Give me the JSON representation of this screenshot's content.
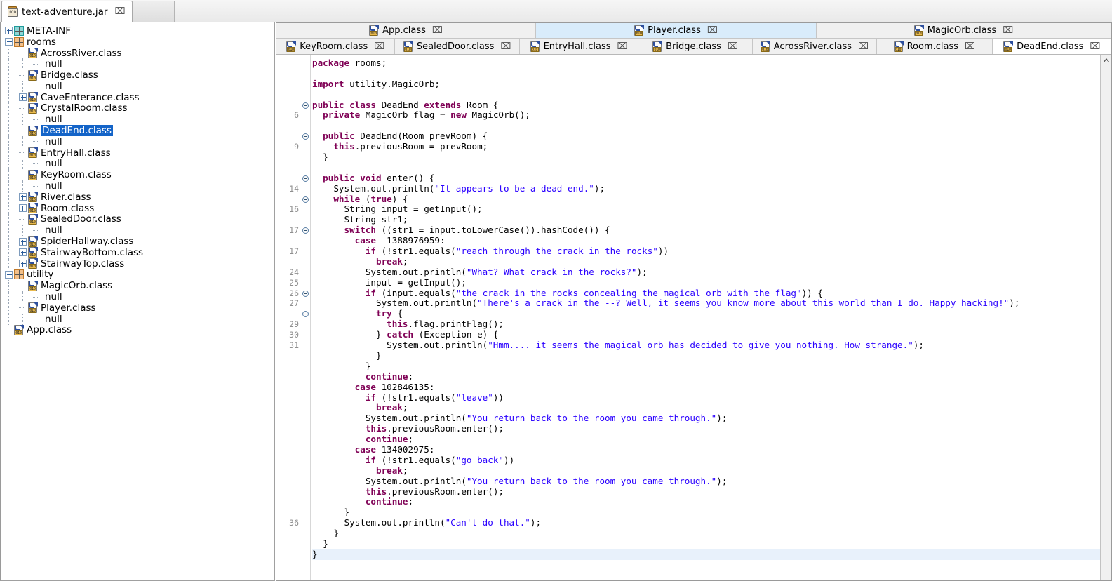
{
  "window": {
    "jar_tab": {
      "label": "text-adventure.jar",
      "icon": "jar-icon",
      "close": "⌧"
    }
  },
  "tree": {
    "nodes": [
      {
        "depth": 0,
        "label": "META-INF",
        "kind": "package",
        "icon": "package-icon",
        "expander": "plus",
        "color": "#1f9b9b"
      },
      {
        "depth": 0,
        "label": "rooms",
        "kind": "package",
        "icon": "package-icon",
        "expander": "minus",
        "color": "#c07a2c"
      },
      {
        "depth": 1,
        "label": "AcrossRiver.class",
        "kind": "class",
        "icon": "class-icon",
        "expander": "none"
      },
      {
        "depth": 2,
        "label": "null",
        "kind": "null",
        "icon": "none",
        "expander": "none"
      },
      {
        "depth": 1,
        "label": "Bridge.class",
        "kind": "class",
        "icon": "class-icon",
        "expander": "none"
      },
      {
        "depth": 2,
        "label": "null",
        "kind": "null",
        "icon": "none",
        "expander": "none"
      },
      {
        "depth": 1,
        "label": "CaveEnterance.class",
        "kind": "class",
        "icon": "class-icon",
        "expander": "plus"
      },
      {
        "depth": 1,
        "label": "CrystalRoom.class",
        "kind": "class",
        "icon": "class-icon",
        "expander": "none"
      },
      {
        "depth": 2,
        "label": "null",
        "kind": "null",
        "icon": "none",
        "expander": "none"
      },
      {
        "depth": 1,
        "label": "DeadEnd.class",
        "kind": "class",
        "icon": "class-icon",
        "expander": "none",
        "selected": true
      },
      {
        "depth": 2,
        "label": "null",
        "kind": "null",
        "icon": "none",
        "expander": "none"
      },
      {
        "depth": 1,
        "label": "EntryHall.class",
        "kind": "class",
        "icon": "class-icon",
        "expander": "none"
      },
      {
        "depth": 2,
        "label": "null",
        "kind": "null",
        "icon": "none",
        "expander": "none"
      },
      {
        "depth": 1,
        "label": "KeyRoom.class",
        "kind": "class",
        "icon": "class-icon",
        "expander": "none"
      },
      {
        "depth": 2,
        "label": "null",
        "kind": "null",
        "icon": "none",
        "expander": "none"
      },
      {
        "depth": 1,
        "label": "River.class",
        "kind": "class",
        "icon": "class-icon",
        "expander": "plus"
      },
      {
        "depth": 1,
        "label": "Room.class",
        "kind": "class",
        "icon": "class-icon",
        "expander": "plus"
      },
      {
        "depth": 1,
        "label": "SealedDoor.class",
        "kind": "class",
        "icon": "class-icon",
        "expander": "none"
      },
      {
        "depth": 2,
        "label": "null",
        "kind": "null",
        "icon": "none",
        "expander": "none"
      },
      {
        "depth": 1,
        "label": "SpiderHallway.class",
        "kind": "class",
        "icon": "class-icon",
        "expander": "plus"
      },
      {
        "depth": 1,
        "label": "StairwayBottom.class",
        "kind": "class",
        "icon": "class-icon",
        "expander": "plus"
      },
      {
        "depth": 1,
        "label": "StairwayTop.class",
        "kind": "class",
        "icon": "class-icon",
        "expander": "plus"
      },
      {
        "depth": 0,
        "label": "utility",
        "kind": "package",
        "icon": "package-icon",
        "expander": "minus",
        "color": "#c07a2c"
      },
      {
        "depth": 1,
        "label": "MagicOrb.class",
        "kind": "class",
        "icon": "class-icon",
        "expander": "none"
      },
      {
        "depth": 2,
        "label": "null",
        "kind": "null",
        "icon": "none",
        "expander": "none"
      },
      {
        "depth": 1,
        "label": "Player.class",
        "kind": "class",
        "icon": "class-icon",
        "expander": "none"
      },
      {
        "depth": 2,
        "label": "null",
        "kind": "null",
        "icon": "none",
        "expander": "none"
      },
      {
        "depth": 0,
        "label": "App.class",
        "kind": "class",
        "icon": "class-icon",
        "expander": "none",
        "leaf_root": true
      }
    ]
  },
  "editor": {
    "tab_rows": [
      {
        "tabs": [
          {
            "label": "App.class",
            "active": false,
            "highlighted": false,
            "flex": 345
          },
          {
            "label": "Player.class",
            "active": false,
            "highlighted": true,
            "flex": 375
          },
          {
            "label": "MagicOrb.class",
            "active": false,
            "highlighted": false,
            "flex": 395
          }
        ]
      },
      {
        "tabs": [
          {
            "label": "KeyRoom.class",
            "active": false,
            "highlighted": false,
            "flex": 160
          },
          {
            "label": "SealedDoor.class",
            "active": false,
            "highlighted": false,
            "flex": 168
          },
          {
            "label": "EntryHall.class",
            "active": false,
            "highlighted": false,
            "flex": 160
          },
          {
            "label": "Bridge.class",
            "active": false,
            "highlighted": false,
            "flex": 153
          },
          {
            "label": "AcrossRiver.class",
            "active": false,
            "highlighted": false,
            "flex": 168
          },
          {
            "label": "Room.class",
            "active": false,
            "highlighted": false,
            "flex": 155
          },
          {
            "label": "DeadEnd.class",
            "active": true,
            "highlighted": false,
            "flex": 160
          }
        ]
      }
    ],
    "close_glyph": "⌧",
    "scrollbar": {
      "up_arrow": "▲"
    },
    "colors": {
      "keyword": "#7f0055",
      "string": "#2a00ff",
      "plain": "#000000",
      "gutter_text": "#8f8f8f",
      "current_line_bg": "#e8f1fb",
      "selected_tab_bg": "#d9ecfb",
      "tree_selection_bg": "#1464c8"
    },
    "code_lines": [
      {
        "num": "",
        "fold": false,
        "tokens": [
          [
            "kw",
            "package"
          ],
          [
            "pln",
            " rooms;"
          ]
        ]
      },
      {
        "num": "",
        "fold": false,
        "tokens": []
      },
      {
        "num": "",
        "fold": false,
        "tokens": [
          [
            "kw",
            "import"
          ],
          [
            "pln",
            " utility.MagicOrb;"
          ]
        ]
      },
      {
        "num": "",
        "fold": false,
        "tokens": []
      },
      {
        "num": "",
        "fold": true,
        "tokens": [
          [
            "kw",
            "public class"
          ],
          [
            "pln",
            " DeadEnd "
          ],
          [
            "kw",
            "extends"
          ],
          [
            "pln",
            " Room {"
          ]
        ]
      },
      {
        "num": "6",
        "fold": false,
        "tokens": [
          [
            "pln",
            "  "
          ],
          [
            "kw",
            "private"
          ],
          [
            "pln",
            " MagicOrb flag = "
          ],
          [
            "kw",
            "new"
          ],
          [
            "pln",
            " MagicOrb();"
          ]
        ]
      },
      {
        "num": "",
        "fold": false,
        "tokens": []
      },
      {
        "num": "",
        "fold": true,
        "tokens": [
          [
            "pln",
            "  "
          ],
          [
            "kw",
            "public"
          ],
          [
            "pln",
            " DeadEnd(Room prevRoom) {"
          ]
        ]
      },
      {
        "num": "9",
        "fold": false,
        "tokens": [
          [
            "pln",
            "    "
          ],
          [
            "kw",
            "this"
          ],
          [
            "pln",
            ".previousRoom = prevRoom;"
          ]
        ]
      },
      {
        "num": "",
        "fold": false,
        "tokens": [
          [
            "pln",
            "  }"
          ]
        ]
      },
      {
        "num": "",
        "fold": false,
        "tokens": []
      },
      {
        "num": "",
        "fold": true,
        "tokens": [
          [
            "pln",
            "  "
          ],
          [
            "kw",
            "public void"
          ],
          [
            "pln",
            " enter() {"
          ]
        ]
      },
      {
        "num": "14",
        "fold": false,
        "tokens": [
          [
            "pln",
            "    System.out.println("
          ],
          [
            "str",
            "\"It appears to be a dead end.\""
          ],
          [
            "pln",
            ");"
          ]
        ]
      },
      {
        "num": "",
        "fold": true,
        "tokens": [
          [
            "pln",
            "    "
          ],
          [
            "kw",
            "while"
          ],
          [
            "pln",
            " ("
          ],
          [
            "kw",
            "true"
          ],
          [
            "pln",
            ") {"
          ]
        ]
      },
      {
        "num": "16",
        "fold": false,
        "tokens": [
          [
            "pln",
            "      String input = getInput();"
          ]
        ]
      },
      {
        "num": "",
        "fold": false,
        "tokens": [
          [
            "pln",
            "      String str1;"
          ]
        ]
      },
      {
        "num": "17",
        "fold": true,
        "tokens": [
          [
            "pln",
            "      "
          ],
          [
            "kw",
            "switch"
          ],
          [
            "pln",
            " ((str1 = input.toLowerCase()).hashCode()) {"
          ]
        ]
      },
      {
        "num": "",
        "fold": false,
        "tokens": [
          [
            "pln",
            "        "
          ],
          [
            "kw",
            "case"
          ],
          [
            "pln",
            " -1388976959:"
          ]
        ]
      },
      {
        "num": "17",
        "fold": false,
        "tokens": [
          [
            "pln",
            "          "
          ],
          [
            "kw",
            "if"
          ],
          [
            "pln",
            " (!str1.equals("
          ],
          [
            "str",
            "\"reach through the crack in the rocks\""
          ],
          [
            "pln",
            "))"
          ]
        ]
      },
      {
        "num": "",
        "fold": false,
        "tokens": [
          [
            "pln",
            "            "
          ],
          [
            "kw",
            "break"
          ],
          [
            "pln",
            ";"
          ]
        ]
      },
      {
        "num": "24",
        "fold": false,
        "tokens": [
          [
            "pln",
            "          System.out.println("
          ],
          [
            "str",
            "\"What? What crack in the rocks?\""
          ],
          [
            "pln",
            ");"
          ]
        ]
      },
      {
        "num": "25",
        "fold": false,
        "tokens": [
          [
            "pln",
            "          input = getInput();"
          ]
        ]
      },
      {
        "num": "26",
        "fold": true,
        "tokens": [
          [
            "pln",
            "          "
          ],
          [
            "kw",
            "if"
          ],
          [
            "pln",
            " (input.equals("
          ],
          [
            "str",
            "\"the crack in the rocks concealing the magical orb with the flag\""
          ],
          [
            "pln",
            ")) {"
          ]
        ]
      },
      {
        "num": "27",
        "fold": false,
        "tokens": [
          [
            "pln",
            "            System.out.println("
          ],
          [
            "str",
            "\"There's a crack in the --? Well, it seems you know more about this world than I do. Happy hacking!\""
          ],
          [
            "pln",
            ");"
          ]
        ]
      },
      {
        "num": "",
        "fold": true,
        "tokens": [
          [
            "pln",
            "            "
          ],
          [
            "kw",
            "try"
          ],
          [
            "pln",
            " {"
          ]
        ]
      },
      {
        "num": "29",
        "fold": false,
        "tokens": [
          [
            "pln",
            "              "
          ],
          [
            "kw",
            "this"
          ],
          [
            "pln",
            ".flag.printFlag();"
          ]
        ]
      },
      {
        "num": "30",
        "fold": false,
        "tokens": [
          [
            "pln",
            "            } "
          ],
          [
            "kw",
            "catch"
          ],
          [
            "pln",
            " (Exception e) {"
          ]
        ]
      },
      {
        "num": "31",
        "fold": false,
        "tokens": [
          [
            "pln",
            "              System.out.println("
          ],
          [
            "str",
            "\"Hmm.... it seems the magical orb has decided to give you nothing. How strange.\""
          ],
          [
            "pln",
            ");"
          ]
        ]
      },
      {
        "num": "",
        "fold": false,
        "tokens": [
          [
            "pln",
            "            }"
          ]
        ]
      },
      {
        "num": "",
        "fold": false,
        "tokens": [
          [
            "pln",
            "          }"
          ]
        ]
      },
      {
        "num": "",
        "fold": false,
        "tokens": [
          [
            "pln",
            "          "
          ],
          [
            "kw",
            "continue"
          ],
          [
            "pln",
            ";"
          ]
        ]
      },
      {
        "num": "",
        "fold": false,
        "tokens": [
          [
            "pln",
            "        "
          ],
          [
            "kw",
            "case"
          ],
          [
            "pln",
            " 102846135:"
          ]
        ]
      },
      {
        "num": "",
        "fold": false,
        "tokens": [
          [
            "pln",
            "          "
          ],
          [
            "kw",
            "if"
          ],
          [
            "pln",
            " (!str1.equals("
          ],
          [
            "str",
            "\"leave\""
          ],
          [
            "pln",
            "))"
          ]
        ]
      },
      {
        "num": "",
        "fold": false,
        "tokens": [
          [
            "pln",
            "            "
          ],
          [
            "kw",
            "break"
          ],
          [
            "pln",
            ";"
          ]
        ]
      },
      {
        "num": "",
        "fold": false,
        "tokens": [
          [
            "pln",
            "          System.out.println("
          ],
          [
            "str",
            "\"You return back to the room you came through.\""
          ],
          [
            "pln",
            ");"
          ]
        ]
      },
      {
        "num": "",
        "fold": false,
        "tokens": [
          [
            "pln",
            "          "
          ],
          [
            "kw",
            "this"
          ],
          [
            "pln",
            ".previousRoom.enter();"
          ]
        ]
      },
      {
        "num": "",
        "fold": false,
        "tokens": [
          [
            "pln",
            "          "
          ],
          [
            "kw",
            "continue"
          ],
          [
            "pln",
            ";"
          ]
        ]
      },
      {
        "num": "",
        "fold": false,
        "tokens": [
          [
            "pln",
            "        "
          ],
          [
            "kw",
            "case"
          ],
          [
            "pln",
            " 134002975:"
          ]
        ]
      },
      {
        "num": "",
        "fold": false,
        "tokens": [
          [
            "pln",
            "          "
          ],
          [
            "kw",
            "if"
          ],
          [
            "pln",
            " (!str1.equals("
          ],
          [
            "str",
            "\"go back\""
          ],
          [
            "pln",
            "))"
          ]
        ]
      },
      {
        "num": "",
        "fold": false,
        "tokens": [
          [
            "pln",
            "            "
          ],
          [
            "kw",
            "break"
          ],
          [
            "pln",
            ";"
          ]
        ]
      },
      {
        "num": "",
        "fold": false,
        "tokens": [
          [
            "pln",
            "          System.out.println("
          ],
          [
            "str",
            "\"You return back to the room you came through.\""
          ],
          [
            "pln",
            ");"
          ]
        ]
      },
      {
        "num": "",
        "fold": false,
        "tokens": [
          [
            "pln",
            "          "
          ],
          [
            "kw",
            "this"
          ],
          [
            "pln",
            ".previousRoom.enter();"
          ]
        ]
      },
      {
        "num": "",
        "fold": false,
        "tokens": [
          [
            "pln",
            "          "
          ],
          [
            "kw",
            "continue"
          ],
          [
            "pln",
            ";"
          ]
        ]
      },
      {
        "num": "",
        "fold": false,
        "tokens": [
          [
            "pln",
            "      }"
          ]
        ]
      },
      {
        "num": "36",
        "fold": false,
        "tokens": [
          [
            "pln",
            "      System.out.println("
          ],
          [
            "str",
            "\"Can't do that.\""
          ],
          [
            "pln",
            ");"
          ]
        ]
      },
      {
        "num": "",
        "fold": false,
        "tokens": [
          [
            "pln",
            "    }"
          ]
        ]
      },
      {
        "num": "",
        "fold": false,
        "tokens": [
          [
            "pln",
            "  }"
          ]
        ]
      },
      {
        "num": "",
        "fold": false,
        "current": true,
        "tokens": [
          [
            "pln",
            "}"
          ]
        ]
      }
    ]
  }
}
